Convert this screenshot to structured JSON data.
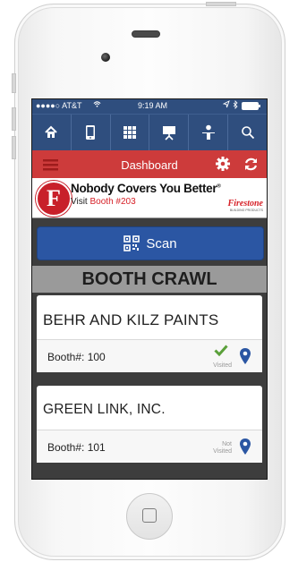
{
  "status": {
    "carrier": "●●●●○ AT&T",
    "time": "9:19 AM"
  },
  "nav_icons": [
    "home-icon",
    "phone-icon",
    "grid-icon",
    "presentation-icon",
    "person-icon",
    "search-icon"
  ],
  "header": {
    "title": "Dashboard"
  },
  "banner": {
    "headline": "Nobody Covers You Better",
    "tm": "®",
    "visit_prefix": "Visit ",
    "booth": "Booth #203",
    "brand": "Firestone",
    "brand_sub": "BUILDING PRODUCTS",
    "logo_letter": "F"
  },
  "scan": {
    "label": "Scan"
  },
  "booth_crawl": {
    "title": "BOOTH CRAWL"
  },
  "booths": [
    {
      "name": "BEHR AND KILZ PAINTS",
      "booth": "Booth#: 100",
      "status": "Visited"
    },
    {
      "name": "GREEN LINK, INC.",
      "booth": "Booth#: 101",
      "status_line1": "Not",
      "status_line2": "Visited"
    }
  ],
  "colors": {
    "nav": "#2f4e7e",
    "header": "#cd3b3b",
    "scan": "#2b56a3",
    "pin": "#2b56a3",
    "check": "#5aa03a"
  }
}
